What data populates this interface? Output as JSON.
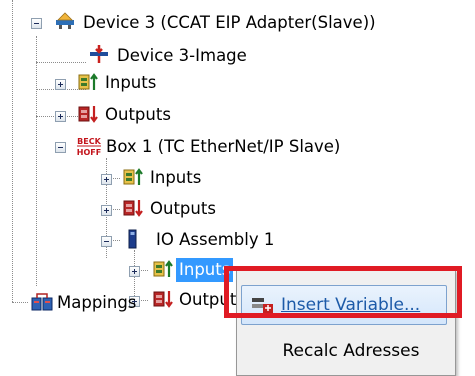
{
  "tree": {
    "device3": {
      "label": "Device 3 (CCAT EIP Adapter(Slave))",
      "icon": "device-adapter-icon"
    },
    "device3_image": {
      "label": "Device 3-Image",
      "icon": "process-image-icon"
    },
    "device3_inputs": {
      "label": "Inputs",
      "icon": "inputs-icon"
    },
    "device3_outputs": {
      "label": "Outputs",
      "icon": "outputs-icon"
    },
    "box1": {
      "label": "Box 1 (TC EtherNet/IP Slave)",
      "icon": "beckhoff-box-icon",
      "icon_text_top": "BECK",
      "icon_text_bottom": "HOFF"
    },
    "box1_inputs": {
      "label": "Inputs",
      "icon": "inputs-icon"
    },
    "box1_outputs": {
      "label": "Outputs",
      "icon": "outputs-icon"
    },
    "io_assembly": {
      "label": "IO Assembly 1",
      "icon": "io-assembly-icon"
    },
    "asm_inputs": {
      "label": "Inputs",
      "icon": "inputs-icon",
      "selected": true
    },
    "asm_outputs": {
      "label": "Outputs",
      "icon": "outputs-icon"
    },
    "mappings": {
      "label": "Mappings",
      "icon": "mappings-icon"
    }
  },
  "context_menu": {
    "insert_variable": "Insert Variable...",
    "recalc": "Recalc Adresses"
  },
  "colors": {
    "selection": "#3399ff",
    "highlight_box": "#e01b24",
    "menu_link": "#1c5aa8"
  }
}
